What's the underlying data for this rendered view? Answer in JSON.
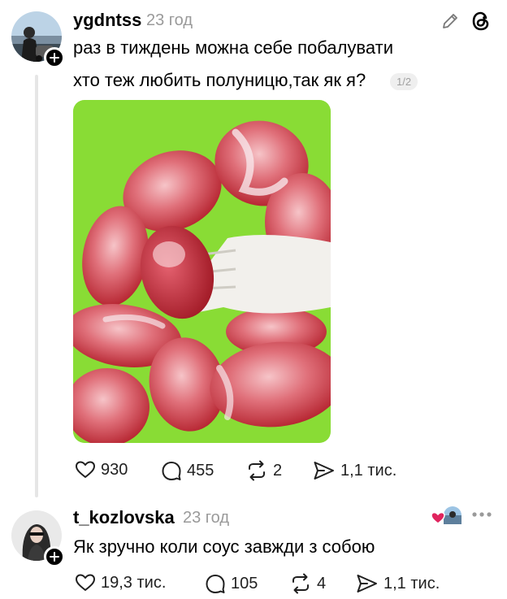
{
  "post": {
    "username": "ygdntss",
    "time": "23 год",
    "lines": [
      "раз в тиждень можна себе побалувати",
      "хто теж любить полуницю,так як я?"
    ],
    "page_indicator": "1/2",
    "actions": {
      "likes": "930",
      "comments": "455",
      "reposts": "2",
      "shares": "1,1 тис."
    }
  },
  "reply": {
    "username": "t_kozlovska",
    "time": "23 год",
    "text": "Як зручно коли соус завжди з собою",
    "actions": {
      "likes": "19,3 тис.",
      "comments": "105",
      "reposts": "4",
      "shares": "1,1 тис."
    }
  },
  "icons": {
    "edit": "pencil-icon",
    "threads": "threads-logo-icon",
    "like": "heart-icon",
    "comment": "comment-bubble-icon",
    "repost": "repost-icon",
    "share": "send-icon",
    "more": "more-dots-icon",
    "liked_by_author": "author-liked-badge-icon"
  },
  "colors": {
    "image_background": "#8fe03a",
    "liked_heart": "#e0245e",
    "muted_text": "#9a9a9a"
  }
}
